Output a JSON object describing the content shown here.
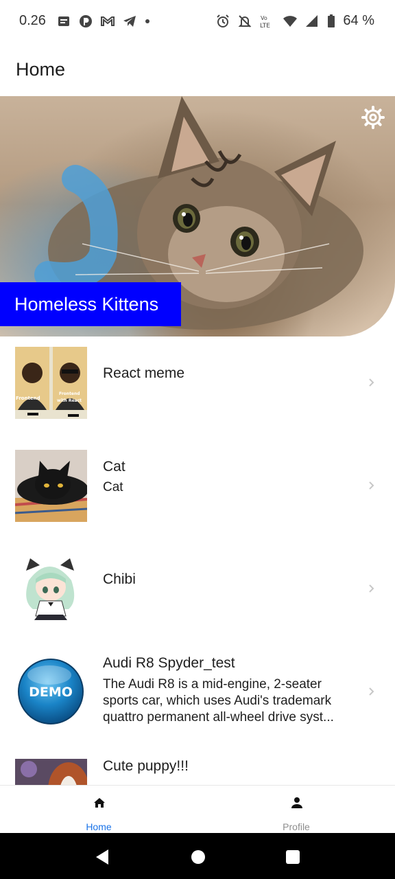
{
  "status_bar": {
    "time": "0.26",
    "battery": "64 %",
    "icons": [
      "notes-icon",
      "p-circle-icon",
      "gmail-icon",
      "telegram-icon",
      "dot-icon",
      "alarm-icon",
      "bell-off-icon",
      "volte-icon",
      "wifi-icon",
      "signal-icon",
      "battery-icon"
    ]
  },
  "header": {
    "title": "Home"
  },
  "hero": {
    "label": "Homeless Kittens",
    "label_bg": "#0000ff",
    "settings_icon": "gear-icon"
  },
  "list": {
    "items": [
      {
        "title": "React meme",
        "subtitle": ""
      },
      {
        "title": "Cat",
        "subtitle": "Cat"
      },
      {
        "title": "Chibi",
        "subtitle": ""
      },
      {
        "title": "Audi R8 Spyder_test",
        "subtitle": "The Audi R8 is a mid-engine, 2-seater sports car, which uses Audi's trademark quattro permanent all-wheel drive syst..."
      },
      {
        "title": "Cute puppy!!!",
        "subtitle": ""
      }
    ],
    "thumb_texts": {
      "meme_left": "Frontend",
      "meme_right": "Frontend with React",
      "demo": "DEMO"
    }
  },
  "bottom_nav": {
    "tabs": [
      {
        "label": "Home",
        "icon": "home-icon",
        "active": true
      },
      {
        "label": "Profile",
        "icon": "person-icon",
        "active": false
      }
    ],
    "active_color": "#1a73e8"
  },
  "system_nav": {
    "icons": [
      "back-icon",
      "home-circle-icon",
      "recents-icon"
    ]
  }
}
